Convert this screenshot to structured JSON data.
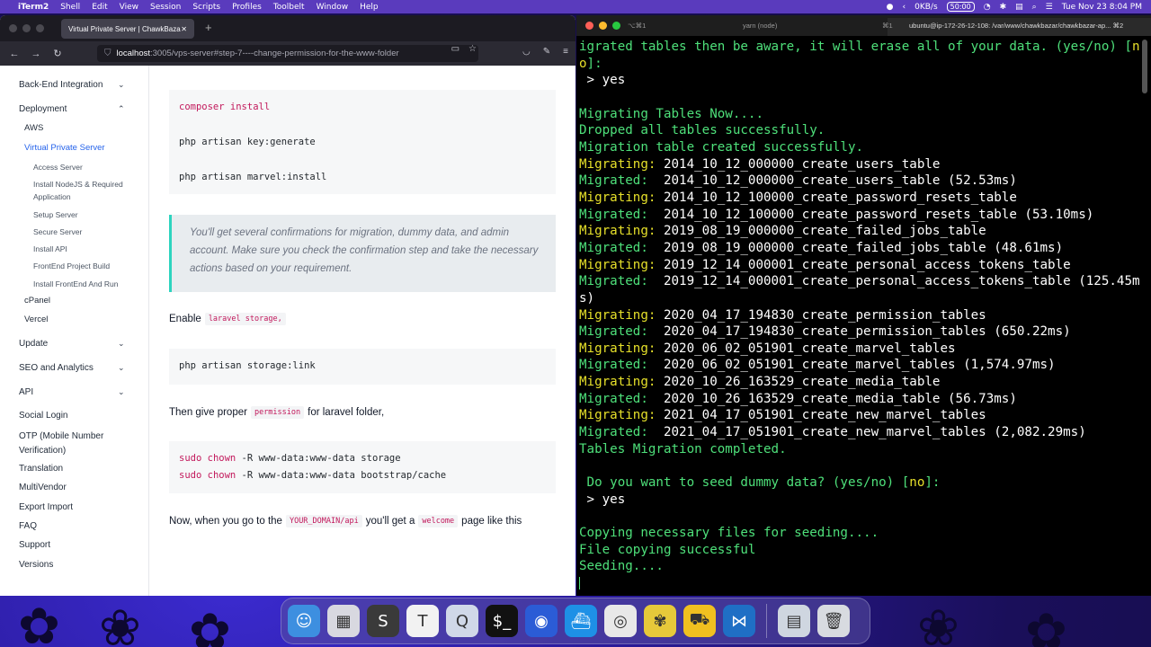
{
  "menubar": {
    "apple": "",
    "items": [
      "iTerm2",
      "Shell",
      "Edit",
      "View",
      "Session",
      "Scripts",
      "Profiles",
      "Toolbelt",
      "Window",
      "Help"
    ],
    "network": "0KB/s",
    "battery_time": "50:00",
    "datetime": "Tue Nov 23  8:04 PM"
  },
  "browser": {
    "tab_title": "Virtual Private Server | ChawkBazar",
    "tab_close": "✕",
    "new_tab": "+",
    "url_host": "localhost",
    "url_path": ":3005/vps-server#step-7----change-permission-for-the-www-folder",
    "sidebar": {
      "sections": [
        {
          "label": "Back-End Integration",
          "chevron": "down"
        },
        {
          "label": "Deployment",
          "chevron": "up"
        }
      ],
      "deployment_children": [
        "AWS",
        "Virtual Private Server"
      ],
      "vps_children": [
        "Access Server",
        "Install NodeJS & Required Application",
        "Setup Server",
        "Secure Server",
        "Install API",
        "FrontEnd Project Build",
        "Install FrontEnd And Run"
      ],
      "deployment_more": [
        "cPanel",
        "Vercel"
      ],
      "collapsed_sections": [
        "Update",
        "SEO and Analytics",
        "API"
      ],
      "plain_items": [
        "Social Login",
        "OTP (Mobile Number Verification)",
        "Translation",
        "MultiVendor",
        "Export Import",
        "FAQ",
        "Support",
        "Versions"
      ]
    },
    "main": {
      "code1": {
        "line1_kw1": "composer",
        "line1_kw2": "install",
        "line2": "php artisan key:generate",
        "line3": "php artisan marvel:install"
      },
      "callout": "You'll get several confirmations for migration, dummy data, and admin account. Make sure you check the confirmation step and take the necessary actions based on your requirement.",
      "enable_text": "Enable",
      "enable_code": "laravel storage,",
      "code2": "php artisan storage:link",
      "perm_text_before": "Then give proper",
      "perm_code": "permission",
      "perm_text_after": "for laravel folder,",
      "code3": {
        "kw1": "sudo",
        "kw2": "chown",
        "line1_rest": " -R www-data:www-data storage",
        "line2_rest": " -R www-data:www-data bootstrap/cache"
      },
      "final_text_1": "Now, when you go to the",
      "final_code_1": "YOUR_DOMAIN/api",
      "final_text_2": "you'll get a",
      "final_code_2": "welcome",
      "final_text_3": "page like this"
    }
  },
  "terminal": {
    "tab1_shortcut": "⌥⌘1",
    "tab2_title": "yarn (node)",
    "tab3_shortcut": "⌘1",
    "tab4_title": "ubuntu@ip-172-26-12-108: /var/www/chawkbazar/chawkbazar-ap... ⌘2",
    "lines": [
      {
        "parts": [
          {
            "c": "green",
            "t": "igrated tables then be aware, it will erase all of your data. (yes/no) ["
          },
          {
            "c": "yellow",
            "t": "n"
          }
        ]
      },
      {
        "parts": [
          {
            "c": "yellow",
            "t": "o"
          },
          {
            "c": "green",
            "t": "]:"
          }
        ]
      },
      {
        "parts": [
          {
            "c": "white",
            "t": " > yes"
          }
        ]
      },
      {
        "parts": [
          {
            "c": "white",
            "t": ""
          }
        ]
      },
      {
        "parts": [
          {
            "c": "green",
            "t": "Migrating Tables Now...."
          }
        ]
      },
      {
        "parts": [
          {
            "c": "green",
            "t": "Dropped all tables successfully."
          }
        ]
      },
      {
        "parts": [
          {
            "c": "green",
            "t": "Migration table created successfully."
          }
        ]
      },
      {
        "parts": [
          {
            "c": "yellow",
            "t": "Migrating:"
          },
          {
            "c": "white",
            "t": " 2014_10_12_000000_create_users_table"
          }
        ]
      },
      {
        "parts": [
          {
            "c": "green",
            "t": "Migrated: "
          },
          {
            "c": "white",
            "t": " 2014_10_12_000000_create_users_table (52.53ms)"
          }
        ]
      },
      {
        "parts": [
          {
            "c": "yellow",
            "t": "Migrating:"
          },
          {
            "c": "white",
            "t": " 2014_10_12_100000_create_password_resets_table"
          }
        ]
      },
      {
        "parts": [
          {
            "c": "green",
            "t": "Migrated: "
          },
          {
            "c": "white",
            "t": " 2014_10_12_100000_create_password_resets_table (53.10ms)"
          }
        ]
      },
      {
        "parts": [
          {
            "c": "yellow",
            "t": "Migrating:"
          },
          {
            "c": "white",
            "t": " 2019_08_19_000000_create_failed_jobs_table"
          }
        ]
      },
      {
        "parts": [
          {
            "c": "green",
            "t": "Migrated: "
          },
          {
            "c": "white",
            "t": " 2019_08_19_000000_create_failed_jobs_table (48.61ms)"
          }
        ]
      },
      {
        "parts": [
          {
            "c": "yellow",
            "t": "Migrating:"
          },
          {
            "c": "white",
            "t": " 2019_12_14_000001_create_personal_access_tokens_table"
          }
        ]
      },
      {
        "parts": [
          {
            "c": "green",
            "t": "Migrated: "
          },
          {
            "c": "white",
            "t": " 2019_12_14_000001_create_personal_access_tokens_table (125.45m"
          }
        ]
      },
      {
        "parts": [
          {
            "c": "white",
            "t": "s)"
          }
        ]
      },
      {
        "parts": [
          {
            "c": "yellow",
            "t": "Migrating:"
          },
          {
            "c": "white",
            "t": " 2020_04_17_194830_create_permission_tables"
          }
        ]
      },
      {
        "parts": [
          {
            "c": "green",
            "t": "Migrated: "
          },
          {
            "c": "white",
            "t": " 2020_04_17_194830_create_permission_tables (650.22ms)"
          }
        ]
      },
      {
        "parts": [
          {
            "c": "yellow",
            "t": "Migrating:"
          },
          {
            "c": "white",
            "t": " 2020_06_02_051901_create_marvel_tables"
          }
        ]
      },
      {
        "parts": [
          {
            "c": "green",
            "t": "Migrated: "
          },
          {
            "c": "white",
            "t": " 2020_06_02_051901_create_marvel_tables (1,574.97ms)"
          }
        ]
      },
      {
        "parts": [
          {
            "c": "yellow",
            "t": "Migrating:"
          },
          {
            "c": "white",
            "t": " 2020_10_26_163529_create_media_table"
          }
        ]
      },
      {
        "parts": [
          {
            "c": "green",
            "t": "Migrated: "
          },
          {
            "c": "white",
            "t": " 2020_10_26_163529_create_media_table (56.73ms)"
          }
        ]
      },
      {
        "parts": [
          {
            "c": "yellow",
            "t": "Migrating:"
          },
          {
            "c": "white",
            "t": " 2021_04_17_051901_create_new_marvel_tables"
          }
        ]
      },
      {
        "parts": [
          {
            "c": "green",
            "t": "Migrated: "
          },
          {
            "c": "white",
            "t": " 2021_04_17_051901_create_new_marvel_tables (2,082.29ms)"
          }
        ]
      },
      {
        "parts": [
          {
            "c": "green",
            "t": "Tables Migration completed."
          }
        ]
      },
      {
        "parts": [
          {
            "c": "white",
            "t": ""
          }
        ]
      },
      {
        "parts": [
          {
            "c": "green",
            "t": " Do you want to seed dummy data? (yes/no) ["
          },
          {
            "c": "yellow",
            "t": "no"
          },
          {
            "c": "green",
            "t": "]:"
          }
        ]
      },
      {
        "parts": [
          {
            "c": "white",
            "t": " > yes"
          }
        ]
      },
      {
        "parts": [
          {
            "c": "white",
            "t": ""
          }
        ]
      },
      {
        "parts": [
          {
            "c": "green",
            "t": "Copying necessary files for seeding...."
          }
        ]
      },
      {
        "parts": [
          {
            "c": "green",
            "t": "File copying successful"
          }
        ]
      },
      {
        "parts": [
          {
            "c": "green",
            "t": "Seeding...."
          }
        ]
      }
    ]
  },
  "dock": {
    "apps": [
      {
        "name": "finder-icon",
        "glyph": "☺",
        "color": "#3d8fe0"
      },
      {
        "name": "launchpad-icon",
        "glyph": "▦",
        "color": "#d8d8e0"
      },
      {
        "name": "sublime-text-icon",
        "glyph": "S",
        "color": "#3a3a3a"
      },
      {
        "name": "typora-icon",
        "glyph": "T",
        "color": "#f2f2f2"
      },
      {
        "name": "quicktime-icon",
        "glyph": "Q",
        "color": "#d0d8e8"
      },
      {
        "name": "iterm-icon",
        "glyph": "$_",
        "color": "#111111"
      },
      {
        "name": "firefox-icon",
        "glyph": "◉",
        "color": "#2b5cd6"
      },
      {
        "name": "docker-icon",
        "glyph": "⛴",
        "color": "#1e90e6"
      },
      {
        "name": "chrome-icon",
        "glyph": "◎",
        "color": "#e8e8e8"
      },
      {
        "name": "tes-icon",
        "glyph": "✾",
        "color": "#e6c93a"
      },
      {
        "name": "forklift-icon",
        "glyph": "⛟",
        "color": "#f0c020"
      },
      {
        "name": "vscode-icon",
        "glyph": "⋈",
        "color": "#1f6fc5"
      }
    ],
    "extras": [
      {
        "name": "downloads-stack-icon",
        "glyph": "▤",
        "color": "#cfd6e0"
      },
      {
        "name": "trash-icon",
        "glyph": "🗑",
        "color": "#d8dbe0"
      }
    ]
  }
}
